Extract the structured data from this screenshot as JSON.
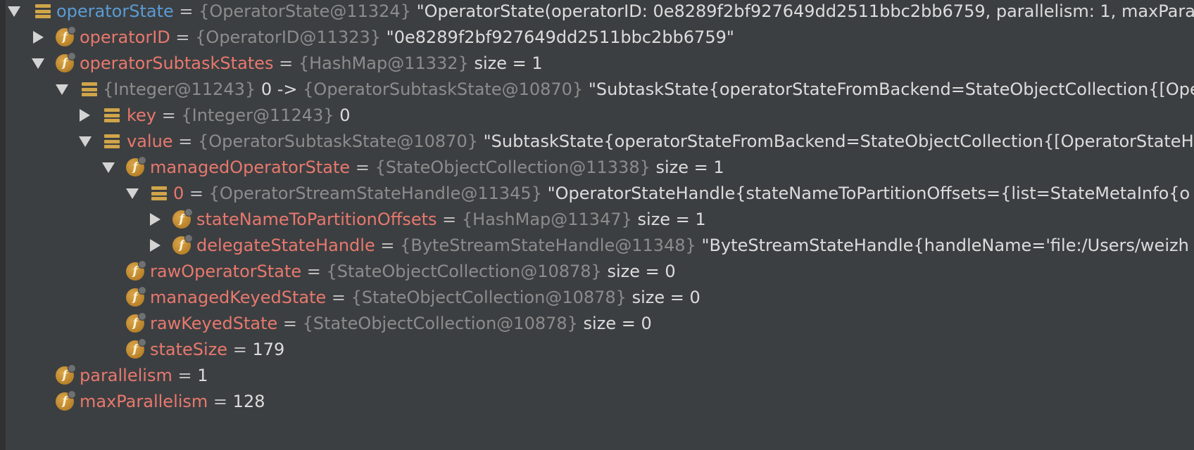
{
  "rows": {
    "r0": {
      "name": "operatorState",
      "eq": " = ",
      "type": "{OperatorState@11324}",
      "value": " \"OperatorState(operatorID: 0e8289f2bf927649dd2511bbc2bb6759, parallelism: 1, maxPara"
    },
    "r1": {
      "name": "operatorID",
      "eq": " = ",
      "type": "{OperatorID@11323}",
      "value": " \"0e8289f2bf927649dd2511bbc2bb6759\""
    },
    "r2": {
      "name": "operatorSubtaskStates",
      "eq": " = ",
      "type": "{HashMap@11332}",
      "value": "  size = 1"
    },
    "r3": {
      "type1": "{Integer@11243}",
      "mid": " 0 -> ",
      "type2": "{OperatorSubtaskState@10870}",
      "value": " \"SubtaskState{operatorStateFromBackend=StateObjectCollection{[Ope"
    },
    "r4": {
      "name": "key",
      "eq": " = ",
      "type": "{Integer@11243}",
      "value": " 0"
    },
    "r5": {
      "name": "value",
      "eq": " = ",
      "type": "{OperatorSubtaskState@10870}",
      "value": " \"SubtaskState{operatorStateFromBackend=StateObjectCollection{[OperatorStateH"
    },
    "r6": {
      "name": "managedOperatorState",
      "eq": " = ",
      "type": "{StateObjectCollection@11338}",
      "value": "  size = 1"
    },
    "r7": {
      "name": "0",
      "eq": " = ",
      "type": "{OperatorStreamStateHandle@11345}",
      "value": " \"OperatorStateHandle{stateNameToPartitionOffsets={list=StateMetaInfo{o"
    },
    "r8": {
      "name": "stateNameToPartitionOffsets",
      "eq": " = ",
      "type": "{HashMap@11347}",
      "value": "  size = 1"
    },
    "r9": {
      "name": "delegateStateHandle",
      "eq": " = ",
      "type": "{ByteStreamStateHandle@11348}",
      "value": " \"ByteStreamStateHandle{handleName='file:/Users/weizh"
    },
    "r10": {
      "name": "rawOperatorState",
      "eq": " = ",
      "type": "{StateObjectCollection@10878}",
      "value": "  size = 0"
    },
    "r11": {
      "name": "managedKeyedState",
      "eq": " = ",
      "type": "{StateObjectCollection@10878}",
      "value": "  size = 0"
    },
    "r12": {
      "name": "rawKeyedState",
      "eq": " = ",
      "type": "{StateObjectCollection@10878}",
      "value": "  size = 0"
    },
    "r13": {
      "name": "stateSize",
      "eq": " = ",
      "value": "179"
    },
    "r14": {
      "name": "parallelism",
      "eq": " = ",
      "value": "1"
    },
    "r15": {
      "name": "maxParallelism",
      "eq": " = ",
      "value": "128"
    }
  },
  "icons": {
    "field": "field-icon",
    "list": "list-icon",
    "field_letter": "f",
    "expanded": "expanded-arrow-icon",
    "collapsed": "collapsed-arrow-icon"
  },
  "colors": {
    "background": "#3c3f41",
    "name_highlight": "#5a9bd5",
    "name": "#e8786e",
    "type": "#8c8c8c",
    "value": "#dcdcdc",
    "field_icon": "#b9822a"
  }
}
